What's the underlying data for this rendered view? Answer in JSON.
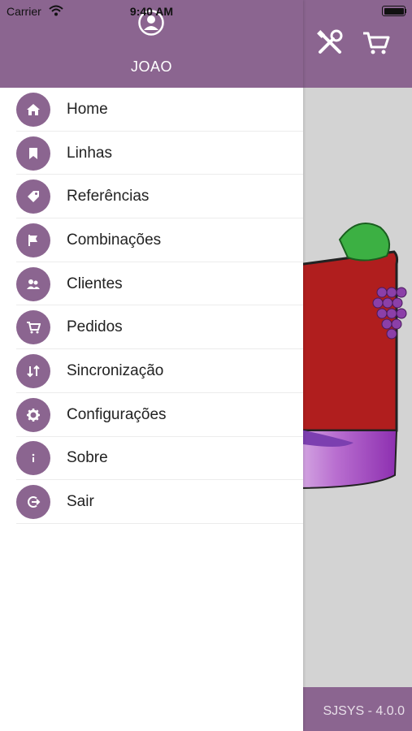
{
  "status_bar": {
    "carrier": "Carrier",
    "time": "9:40 AM"
  },
  "drawer": {
    "username": "JOAO"
  },
  "menu": [
    {
      "label": "Home",
      "icon": "home-icon"
    },
    {
      "label": "Linhas",
      "icon": "bookmark-icon"
    },
    {
      "label": "Referências",
      "icon": "tag-icon"
    },
    {
      "label": "Combinações",
      "icon": "flag-icon"
    },
    {
      "label": "Clientes",
      "icon": "people-icon"
    },
    {
      "label": "Pedidos",
      "icon": "cart-icon"
    },
    {
      "label": "Sincronização",
      "icon": "sync-icon"
    },
    {
      "label": "Configurações",
      "icon": "gear-icon"
    },
    {
      "label": "Sobre",
      "icon": "info-icon"
    },
    {
      "label": "Sair",
      "icon": "logout-icon"
    }
  ],
  "background": {
    "version": "SJSYS - 4.0.0"
  },
  "colors": {
    "accent": "#8b6590",
    "background_gray": "#d3d3d3"
  }
}
